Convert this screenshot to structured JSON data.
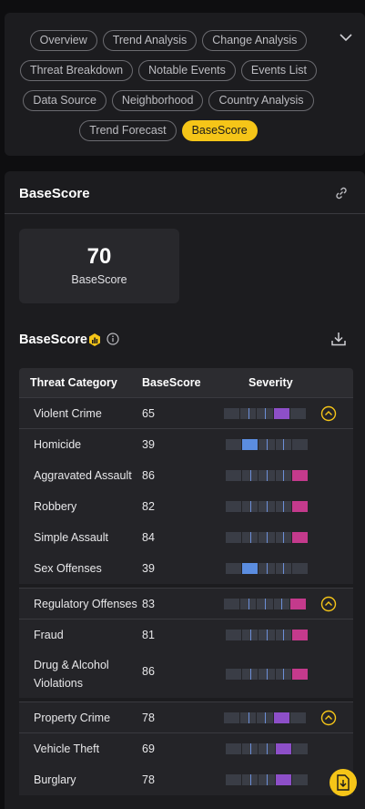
{
  "tabs": [
    [
      "Overview",
      "Trend Analysis",
      "Change Analysis"
    ],
    [
      "Threat Breakdown",
      "Notable Events",
      "Events List"
    ],
    [
      "Data Source",
      "Neighborhood",
      "Country Analysis"
    ],
    [
      "Trend Forecast",
      "BaseScore"
    ]
  ],
  "active_tab": "BaseScore",
  "main": {
    "title": "BaseScore",
    "score_value": "70",
    "score_label": "BaseScore",
    "section_title": "BaseScore"
  },
  "table": {
    "headers": [
      "Threat Category",
      "BaseScore",
      "Severity"
    ],
    "groups": [
      {
        "name": "Violent Crime",
        "score": 65,
        "level": 4,
        "color": "#8d4fc8",
        "children": [
          {
            "name": "Homicide",
            "score": 39,
            "level": 2,
            "color": "#5b8de0"
          },
          {
            "name": "Aggravated Assault",
            "score": 86,
            "level": 5,
            "color": "#c43a8c"
          },
          {
            "name": "Robbery",
            "score": 82,
            "level": 5,
            "color": "#c43a8c"
          },
          {
            "name": "Simple Assault",
            "score": 84,
            "level": 5,
            "color": "#c43a8c"
          },
          {
            "name": "Sex Offenses",
            "score": 39,
            "level": 2,
            "color": "#5b8de0"
          }
        ]
      },
      {
        "name": "Regulatory Offenses",
        "score": 83,
        "level": 5,
        "color": "#c43a8c",
        "children": [
          {
            "name": "Fraud",
            "score": 81,
            "level": 5,
            "color": "#c43a8c"
          },
          {
            "name": "Drug & Alcohol Violations",
            "score": 86,
            "level": 5,
            "color": "#c43a8c"
          }
        ]
      },
      {
        "name": "Property Crime",
        "score": 78,
        "level": 4,
        "color": "#8d4fc8",
        "children": [
          {
            "name": "Vehicle Theft",
            "score": 69,
            "level": 4,
            "color": "#8d4fc8"
          },
          {
            "name": "Burglary",
            "score": 78,
            "level": 4,
            "color": "#8d4fc8"
          }
        ]
      }
    ]
  },
  "colors": {
    "accent": "#f5c518",
    "low": "#5b8de0",
    "mid": "#8d4fc8",
    "high": "#c43a8c"
  },
  "icons": [
    "chevron-down-icon",
    "link-icon",
    "chart-badge-icon",
    "info-icon",
    "download-icon",
    "chevron-up-circle-icon",
    "download-file-icon"
  ]
}
